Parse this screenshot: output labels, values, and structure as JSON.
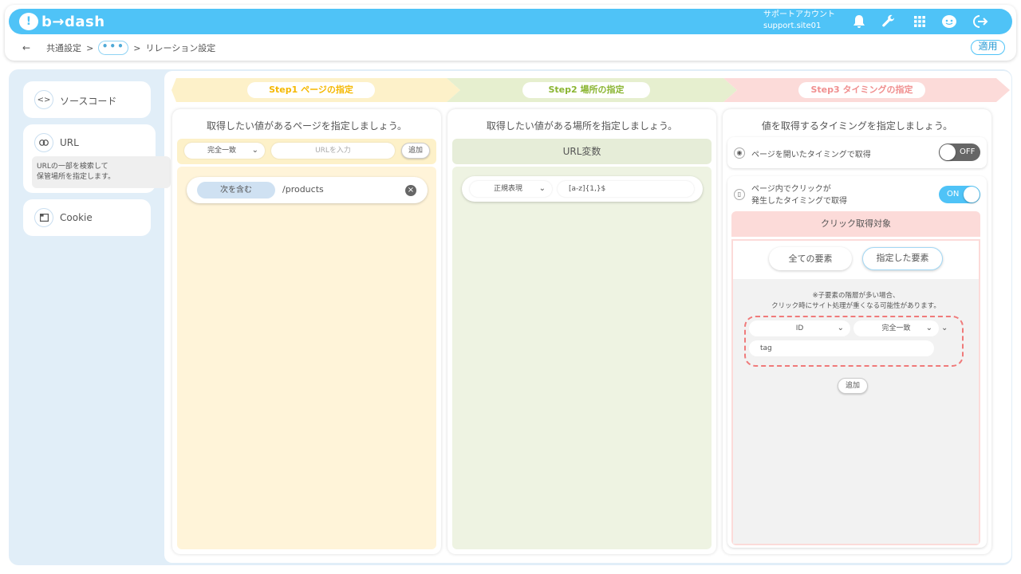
{
  "header": {
    "logo_mark": "!",
    "logo_text": "b→dash",
    "account_label": "サポートアカウント",
    "account_site": "support.site01"
  },
  "breadcrumb": {
    "back": "←",
    "item1": "共通設定",
    "sep1": ">",
    "dots": "•••",
    "sep2": ">",
    "current": "リレーション設定"
  },
  "apply_label": "適用",
  "sidebar": {
    "items": [
      {
        "icon": "<>",
        "label": "ソースコード"
      },
      {
        "icon": "⊖",
        "label": "URL",
        "desc1": "URLの一部を検索して",
        "desc2": "保管場所を指定します。"
      },
      {
        "icon": "▣",
        "label": "Cookie"
      }
    ]
  },
  "steps": [
    {
      "label": "Step1 ページの指定"
    },
    {
      "label": "Step2 場所の指定"
    },
    {
      "label": "Step3 タイミングの指定"
    }
  ],
  "col1": {
    "title": "取得したい値があるページを指定しましょう。",
    "match_select": "完全一致",
    "url_placeholder": "URLを入力",
    "add_label": "追加",
    "rule_type": "次を含む",
    "rule_value": "/products"
  },
  "col2": {
    "title": "取得したい値がある場所を指定しましょう。",
    "section_title": "URL変数",
    "regex_select": "正規表現",
    "regex_value": "[a-z]{1,}$"
  },
  "col3": {
    "title": "値を取得するタイミングを指定しましょう。",
    "opt1_label": "ページを開いたタイミングで取得",
    "opt1_toggle": "OFF",
    "opt2_line1": "ページ内でクリックが",
    "opt2_line2": "発生したタイミングで取得",
    "opt2_toggle": "ON",
    "click_target_title": "クリック取得対象",
    "tab_all": "全ての要素",
    "tab_specified": "指定した要素",
    "note1": "※子要素の階層が多い場合、",
    "note2": "クリック時にサイト処理が重くなる可能性があります。",
    "attr_select": "ID",
    "match_select": "完全一致",
    "tag_value": "tag",
    "add_label": "追加"
  },
  "colors": {
    "brand": "#4fc3f7",
    "step1": "#f5b800",
    "step2": "#8ab531",
    "step3": "#f08f8f",
    "dashed": "#f07a7a"
  }
}
